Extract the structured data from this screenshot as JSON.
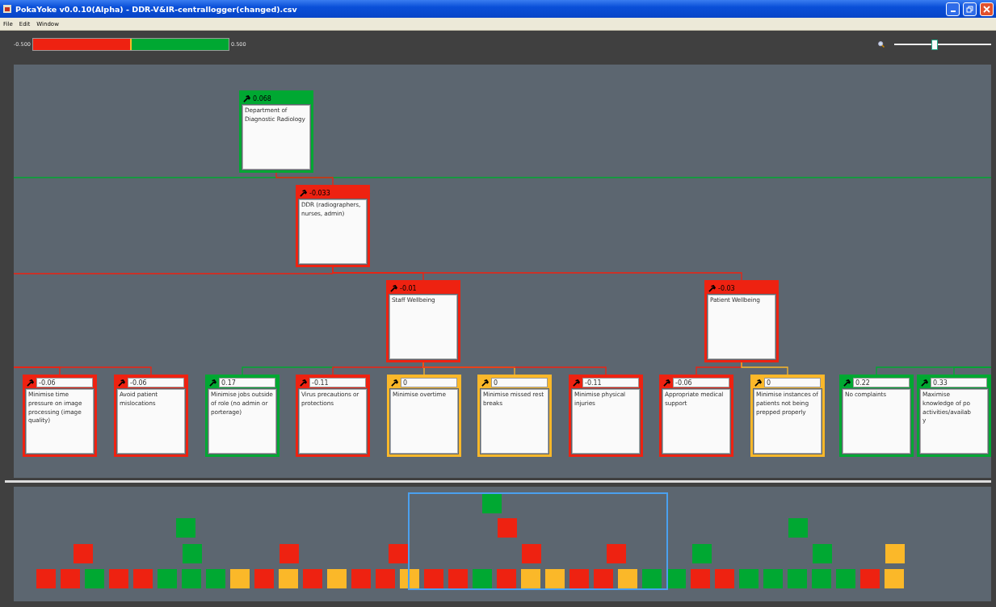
{
  "window": {
    "title": "PokaYoke v0.0.10(Alpha) - DDR-V&IR-centrallogger(changed).csv"
  },
  "menu": [
    "File",
    "Edit",
    "Window"
  ],
  "scale": {
    "min_label": "-0.500",
    "max_label": "0.500"
  },
  "zoom": {
    "level": 0.42
  },
  "tree": {
    "kind": "branch",
    "value": "0.068",
    "color": "#00a832",
    "text": "Department of Diagnostic Radiology",
    "children": [
      {
        "kind": "branch",
        "value": "-0.033",
        "color": "#ee2211",
        "text": "DDR (radiographers, nurses, admin)",
        "children": [
          {
            "kind": "branch",
            "value": "-0.01",
            "color": "#ee2211",
            "text": "Staff Wellbeing",
            "children": [
              {
                "kind": "leaf",
                "value": "-0.11",
                "color": "#ee2211",
                "text": "Virus precautions or protections"
              },
              {
                "kind": "leaf",
                "value": "0",
                "color": "#fbb829",
                "text": "Minimise overtime"
              },
              {
                "kind": "leaf",
                "value": "0",
                "color": "#fbb829",
                "text": "Minimise missed rest breaks"
              },
              {
                "kind": "leaf",
                "value": "-0.11",
                "color": "#ee2211",
                "text": "Minimise physical injuries"
              }
            ]
          },
          {
            "kind": "branch",
            "value": "-0.03",
            "color": "#ee2211",
            "text": "Patient Wellbeing",
            "children": [
              {
                "kind": "leaf",
                "value": "-0.06",
                "color": "#ee2211",
                "text": "Appropriate medical support"
              },
              {
                "kind": "leaf",
                "value": "0",
                "color": "#fbb829",
                "text": "Minimise instances of patients not being prepped properly"
              }
            ]
          }
        ]
      }
    ]
  },
  "other_nodes": [
    {
      "kind": "leaf",
      "value": "-0.06",
      "color": "#ee2211",
      "text": "Minimise time pressure on image processing (image quality)"
    },
    {
      "kind": "leaf",
      "value": "-0.06",
      "color": "#ee2211",
      "text": "Avoid patient mislocations"
    },
    {
      "kind": "leaf",
      "value": "0.17",
      "color": "#00a832",
      "text": "Minimise jobs outside of role (no admin or porterage)"
    },
    {
      "kind": "leaf",
      "value": "0.22",
      "color": "#00a832",
      "text": "No complaints"
    },
    {
      "kind": "leaf",
      "value": "0.33",
      "color": "#00a832",
      "text": "Maximise\nknowledge of po\nactivities/availab\ny"
    }
  ],
  "overview": {
    "rows": [
      [
        {
          "color": "#00a832"
        }
      ],
      [
        {
          "color": "#00a832"
        },
        {
          "color": "#ee2211"
        },
        {
          "color": "#00a832"
        }
      ],
      [
        {
          "color": "#ee2211"
        },
        {
          "color": "#00a832"
        },
        {
          "color": "#ee2211"
        },
        {
          "color": "#ee2211"
        },
        {
          "color": "#ee2211"
        },
        {
          "color": "#ee2211"
        },
        {
          "color": "#00a832"
        },
        {
          "color": "#00a832"
        },
        {
          "color": "#fbb829"
        }
      ],
      [
        {
          "color": "#ee2211"
        },
        {
          "color": "#ee2211"
        },
        {
          "color": "#00a832"
        },
        {
          "color": "#ee2211"
        },
        {
          "color": "#ee2211"
        },
        {
          "color": "#00a832"
        },
        {
          "color": "#00a832"
        },
        {
          "color": "#00a832"
        },
        {
          "color": "#fbb829"
        },
        {
          "color": "#ee2211"
        },
        {
          "color": "#fbb829"
        },
        {
          "color": "#ee2211"
        },
        {
          "color": "#fbb829"
        },
        {
          "color": "#ee2211"
        },
        {
          "color": "#ee2211"
        },
        {
          "color": "#fbb829"
        },
        {
          "color": "#ee2211"
        },
        {
          "color": "#ee2211"
        },
        {
          "color": "#00a832"
        },
        {
          "color": "#ee2211"
        },
        {
          "color": "#fbb829"
        },
        {
          "color": "#fbb829"
        },
        {
          "color": "#ee2211"
        },
        {
          "color": "#ee2211"
        },
        {
          "color": "#fbb829"
        },
        {
          "color": "#00a832"
        },
        {
          "color": "#00a832"
        },
        {
          "color": "#ee2211"
        },
        {
          "color": "#ee2211"
        },
        {
          "color": "#00a832"
        },
        {
          "color": "#00a832"
        },
        {
          "color": "#00a832"
        },
        {
          "color": "#00a832"
        },
        {
          "color": "#00a832"
        },
        {
          "color": "#ee2211"
        },
        {
          "color": "#fbb829"
        }
      ]
    ]
  }
}
